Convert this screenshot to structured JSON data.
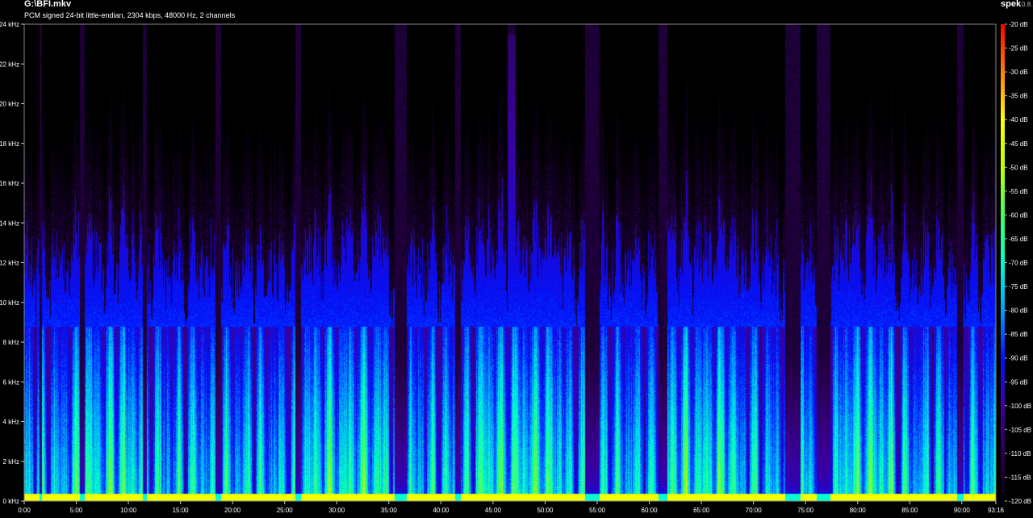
{
  "header": {
    "file_title": "G:\\BFI.mkv",
    "stream_info": "PCM signed 24-bit little-endian, 2304 kbps, 48000 Hz, 2 channels",
    "app_name": "spek",
    "app_version": "0.8.2"
  },
  "chart_data": {
    "type": "heatmap",
    "title": "G:\\BFI.mkv",
    "subtitle": "PCM signed 24-bit little-endian, 2304 kbps, 48000 Hz, 2 channels",
    "x_range_seconds": [
      0,
      5596
    ],
    "y_range_khz": [
      0,
      24
    ],
    "x_ticks": [
      "0:00",
      "5:00",
      "10:00",
      "15:00",
      "20:00",
      "25:00",
      "30:00",
      "35:00",
      "40:00",
      "45:00",
      "50:00",
      "55:00",
      "60:00",
      "65:00",
      "70:00",
      "75:00",
      "80:00",
      "85:00",
      "90:00",
      "93:16"
    ],
    "y_ticks": [
      "0 kHz",
      "2 kHz",
      "4 kHz",
      "6 kHz",
      "8 kHz",
      "10 kHz",
      "12 kHz",
      "14 kHz",
      "16 kHz",
      "18 kHz",
      "20 kHz",
      "22 kHz",
      "24 kHz"
    ],
    "colorbar": {
      "range_db": [
        -120,
        -20
      ],
      "ticks": [
        "-20 dB",
        "-25 dB",
        "-30 dB",
        "-35 dB",
        "-40 dB",
        "-45 dB",
        "-50 dB",
        "-55 dB",
        "-60 dB",
        "-65 dB",
        "-70 dB",
        "-75 dB",
        "-80 dB",
        "-85 dB",
        "-90 dB",
        "-95 dB",
        "-100 dB",
        "-105 dB",
        "-110 dB",
        "-115 dB",
        "-120 dB"
      ],
      "colors": [
        "#000000",
        "#2a0050",
        "#3d00a0",
        "#0010ff",
        "#00a0ff",
        "#00ffd0",
        "#40ff60",
        "#c0ff00",
        "#ffff00",
        "#ff8000",
        "#ff0000"
      ]
    },
    "grid": false,
    "colorbar_position": "right",
    "typical_cutoff_khz": 8.8
  }
}
